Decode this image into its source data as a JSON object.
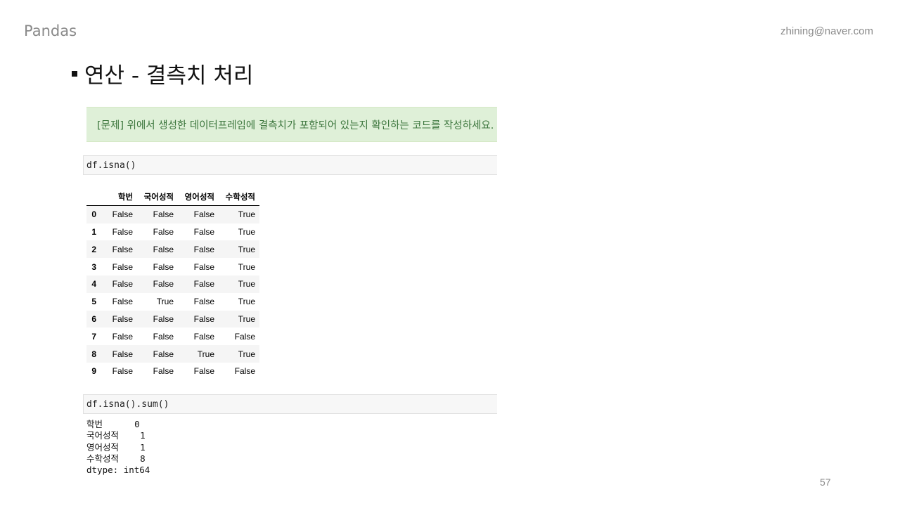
{
  "header": {
    "left": "Pandas",
    "right": "zhining@naver.com"
  },
  "title": "연산 - 결측치 처리",
  "problem": "[문제] 위에서 생성한 데이터프레임에 결측치가 포함되어 있는지 확인하는 코드를 작성하세요.",
  "code1": "df.isna()",
  "table": {
    "columns": [
      "학번",
      "국어성적",
      "영어성적",
      "수학성적"
    ],
    "rows": [
      {
        "index": "0",
        "cells": [
          "False",
          "False",
          "False",
          "True"
        ]
      },
      {
        "index": "1",
        "cells": [
          "False",
          "False",
          "False",
          "True"
        ]
      },
      {
        "index": "2",
        "cells": [
          "False",
          "False",
          "False",
          "True"
        ]
      },
      {
        "index": "3",
        "cells": [
          "False",
          "False",
          "False",
          "True"
        ]
      },
      {
        "index": "4",
        "cells": [
          "False",
          "False",
          "False",
          "True"
        ]
      },
      {
        "index": "5",
        "cells": [
          "False",
          "True",
          "False",
          "True"
        ]
      },
      {
        "index": "6",
        "cells": [
          "False",
          "False",
          "False",
          "True"
        ]
      },
      {
        "index": "7",
        "cells": [
          "False",
          "False",
          "False",
          "False"
        ]
      },
      {
        "index": "8",
        "cells": [
          "False",
          "False",
          "True",
          "True"
        ]
      },
      {
        "index": "9",
        "cells": [
          "False",
          "False",
          "False",
          "False"
        ]
      }
    ]
  },
  "code2": "df.isna().sum()",
  "output": [
    "학번      0",
    "국어성적    1",
    "영어성적    1",
    "수학성적    8",
    "dtype: int64"
  ],
  "page_number": "57"
}
